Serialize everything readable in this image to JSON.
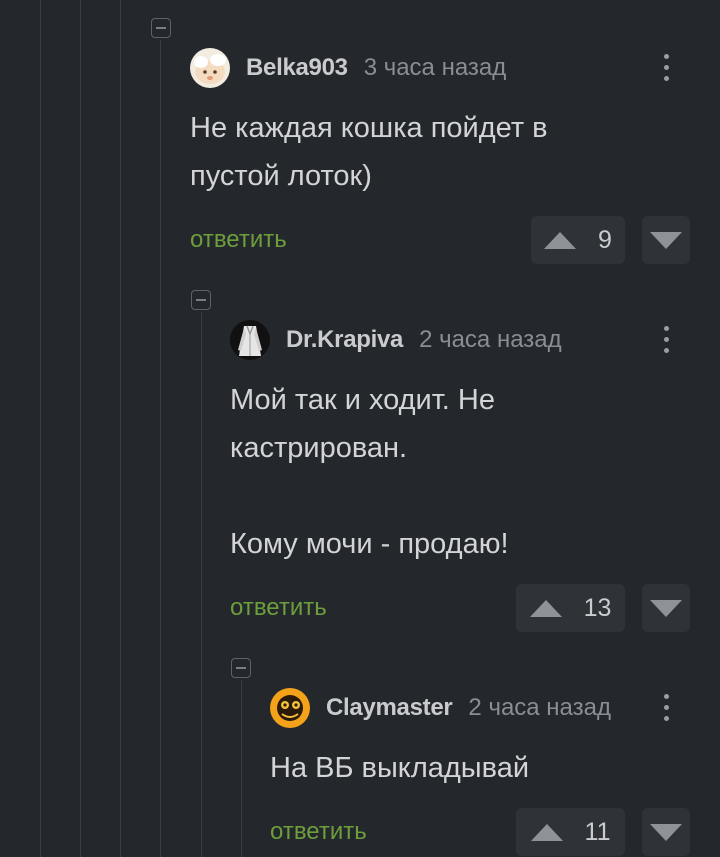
{
  "comments": [
    {
      "author": "Belka903",
      "time": "3 часа назад",
      "text": "Не каждая кошка пойдет в\nпустой лоток)",
      "reply_label": "ответить",
      "rating": "9",
      "avatar_icon": "cartoon-face-avatar-icon"
    },
    {
      "author": "Dr.Krapiva",
      "time": "2 часа назад",
      "text": "Мой так и ходит. Не\nкастрирован.\n\nКому мочи - продаю!",
      "reply_label": "ответить",
      "rating": "13",
      "avatar_icon": "white-coat-avatar-icon"
    },
    {
      "author": "Claymaster",
      "time": "2 часа назад",
      "text": "На ВБ выкладывай",
      "reply_label": "ответить",
      "rating": "11",
      "avatar_icon": "orange-creature-avatar-icon"
    }
  ],
  "colors": {
    "background": "#24272b",
    "reply_link": "#6c9e3c",
    "vote_button_bg": "#2f3237",
    "thread_line": "#3a3d42"
  }
}
